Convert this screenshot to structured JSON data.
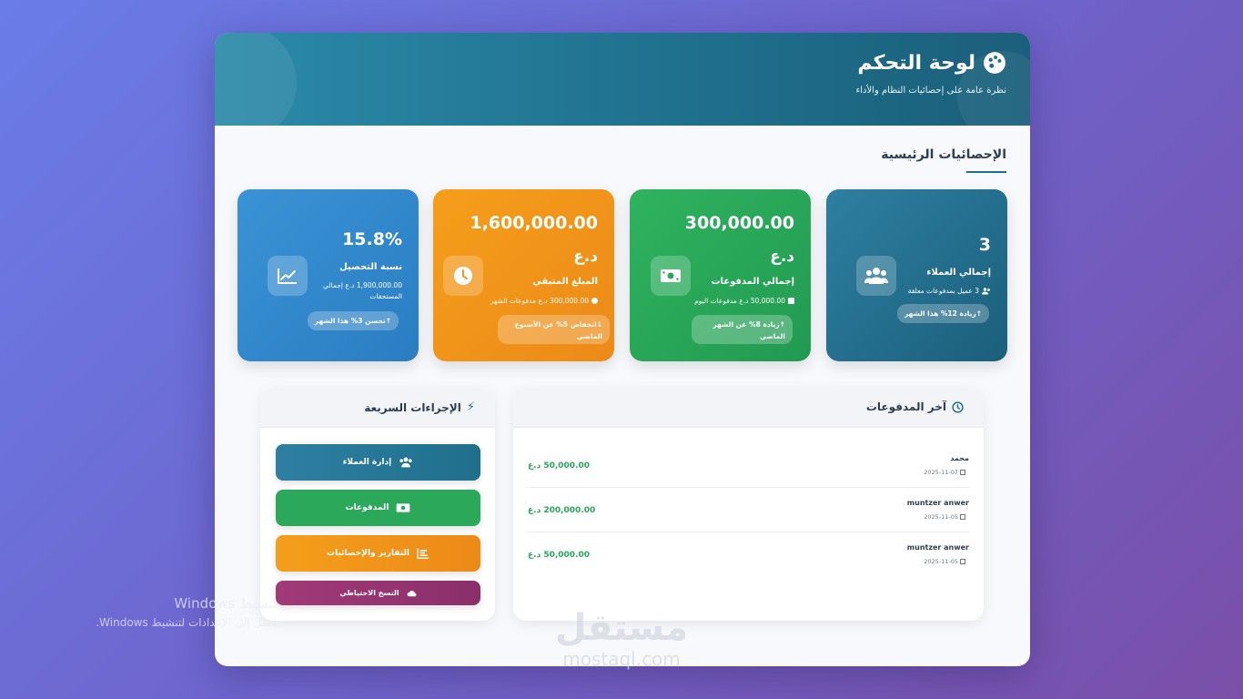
{
  "header": {
    "title": "لوحة التحكم",
    "subtitle": "نظرة عامة على إحصائيات النظام والأداء"
  },
  "section": {
    "title": "الإحصائيات الرئيسية"
  },
  "stats": [
    {
      "value": "3",
      "label": "إجمالي العملاء",
      "meta": "3 عميل بمدفوعات معلقة",
      "badge": "زيادة 12% هذا الشهر",
      "icon": "users-icon",
      "color": "#1f6f8c"
    },
    {
      "value": "300,000.00",
      "unit": "د.ع",
      "label": "إجمالي المدفوعات",
      "meta": "50,000.00 د.ع مدفوعات اليوم",
      "badge": "زيادة 8% عن الشهر الماضي",
      "icon": "money-icon",
      "color": "#2ba85a"
    },
    {
      "value": "1,600,000.00",
      "unit": "د.ع",
      "label": "المبلغ المتبقي",
      "meta": "300,000.00 د.ع مدفوعات الشهر",
      "badge": "انخفاض 5% عن الأسبوع الماضي",
      "icon": "clock-icon",
      "color": "#f29a1c"
    },
    {
      "value": "15.8%",
      "label": "نسبة التحصيل",
      "meta": "1,900,000.00 د.ع إجمالي المستحقات",
      "badge": "تحسن 3% هذا الشهر",
      "icon": "chart-line-icon",
      "color": "#338ad0"
    }
  ],
  "payments": {
    "title": "آخر المدفوعات",
    "rows": [
      {
        "name": "محمد",
        "date": "2025-11-07",
        "amount": "50,000.00 د.ع"
      },
      {
        "name": "muntzer anwer",
        "date": "2025-11-05",
        "amount": "200,000.00 د.ع"
      },
      {
        "name": "muntzer anwer",
        "date": "2025-11-05",
        "amount": "50,000.00 د.ع"
      }
    ]
  },
  "quick": {
    "title": "الإجراءات السريعة",
    "buttons": [
      {
        "label": "إدارة العملاء",
        "icon": "users-icon"
      },
      {
        "label": "المدفوعات",
        "icon": "money-icon"
      },
      {
        "label": "التقارير والإحصائيات",
        "icon": "chart-bar-icon"
      },
      {
        "label": "النسخ الاحتياطي",
        "icon": "cloud-upload-icon"
      }
    ]
  },
  "overlay": {
    "activate_title": "تنشيط Windows",
    "activate_sub": "انتقل إلى الإعدادات لتنشيط Windows.",
    "watermark_ar": "مستقل",
    "watermark_en": "mostaql.com"
  }
}
